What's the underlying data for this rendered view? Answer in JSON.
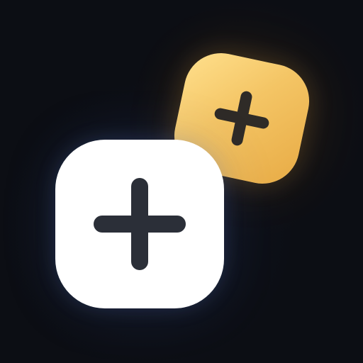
{
  "icons": {
    "primary": {
      "name": "plus-icon",
      "background": "#ffffff",
      "symbol_color": "#2b2f38"
    },
    "secondary": {
      "name": "plus-icon",
      "background": "#f4c565",
      "symbol_color": "#2f2b27"
    }
  },
  "colors": {
    "background": "#0c0e14",
    "glow_blue": "#3a5696",
    "glow_gold": "#b27a20"
  }
}
